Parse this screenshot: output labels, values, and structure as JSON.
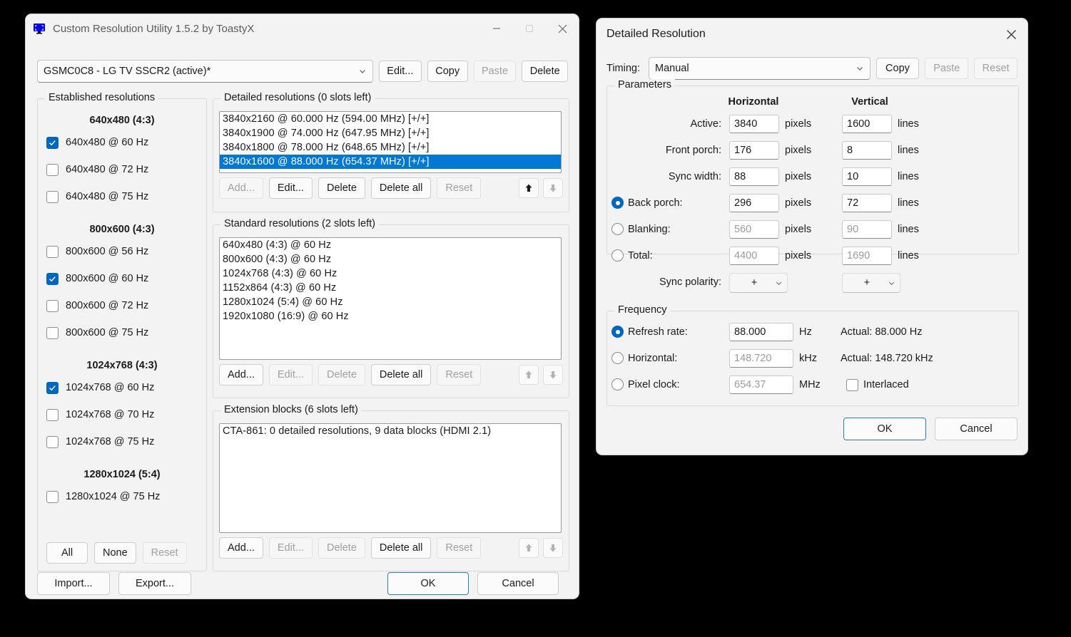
{
  "main_window": {
    "title": "Custom Resolution Utility 1.5.2 by ToastyX",
    "icon": "monitor-icon",
    "window_controls": {
      "minimize": "minimize-icon",
      "maximize": "maximize-icon",
      "close": "close-icon"
    },
    "display_selector": {
      "value": "GSMC0C8 - LG TV SSCR2 (active)*",
      "chevron": "chevron-down-icon"
    },
    "top_buttons": [
      {
        "label": "Edit...",
        "enabled": true
      },
      {
        "label": "Copy",
        "enabled": true
      },
      {
        "label": "Paste",
        "enabled": false
      },
      {
        "label": "Delete",
        "enabled": true
      }
    ],
    "established": {
      "legend": "Established resolutions",
      "groups": [
        {
          "header": "640x480 (4:3)",
          "items": [
            {
              "label": "640x480 @ 60 Hz",
              "checked": true
            },
            {
              "label": "640x480 @ 72 Hz",
              "checked": false
            },
            {
              "label": "640x480 @ 75 Hz",
              "checked": false
            }
          ]
        },
        {
          "header": "800x600 (4:3)",
          "items": [
            {
              "label": "800x600 @ 56 Hz",
              "checked": false
            },
            {
              "label": "800x600 @ 60 Hz",
              "checked": true
            },
            {
              "label": "800x600 @ 72 Hz",
              "checked": false
            },
            {
              "label": "800x600 @ 75 Hz",
              "checked": false
            }
          ]
        },
        {
          "header": "1024x768 (4:3)",
          "items": [
            {
              "label": "1024x768 @ 60 Hz",
              "checked": true
            },
            {
              "label": "1024x768 @ 70 Hz",
              "checked": false
            },
            {
              "label": "1024x768 @ 75 Hz",
              "checked": false
            }
          ]
        },
        {
          "header": "1280x1024 (5:4)",
          "items": [
            {
              "label": "1280x1024 @ 75 Hz",
              "checked": false
            }
          ]
        }
      ],
      "buttons": [
        {
          "label": "All",
          "enabled": true
        },
        {
          "label": "None",
          "enabled": true
        },
        {
          "label": "Reset",
          "enabled": false
        }
      ]
    },
    "detailed": {
      "legend": "Detailed resolutions (0 slots left)",
      "rows": [
        {
          "text": "3840x2160 @ 60.000 Hz (594.00 MHz) [+/+]",
          "selected": false
        },
        {
          "text": "3840x1900 @ 74.000 Hz (647.95 MHz) [+/+]",
          "selected": false
        },
        {
          "text": "3840x1800 @ 78.000 Hz (648.65 MHz) [+/+]",
          "selected": false
        },
        {
          "text": "3840x1600 @ 88.000 Hz (654.37 MHz) [+/+]",
          "selected": true
        }
      ],
      "buttons": [
        {
          "label": "Add...",
          "enabled": false
        },
        {
          "label": "Edit...",
          "enabled": true
        },
        {
          "label": "Delete",
          "enabled": true
        },
        {
          "label": "Delete all",
          "enabled": true
        },
        {
          "label": "Reset",
          "enabled": false
        }
      ],
      "move_up": {
        "icon": "arrow-up-icon",
        "enabled": true
      },
      "move_down": {
        "icon": "arrow-down-icon",
        "enabled": false
      }
    },
    "standard": {
      "legend": "Standard resolutions (2 slots left)",
      "rows": [
        {
          "text": "640x480 (4:3) @ 60 Hz",
          "selected": false
        },
        {
          "text": "800x600 (4:3) @ 60 Hz",
          "selected": false
        },
        {
          "text": "1024x768 (4:3) @ 60 Hz",
          "selected": false
        },
        {
          "text": "1152x864 (4:3) @ 60 Hz",
          "selected": false
        },
        {
          "text": "1280x1024 (5:4) @ 60 Hz",
          "selected": false
        },
        {
          "text": "1920x1080 (16:9) @ 60 Hz",
          "selected": false
        }
      ],
      "buttons": [
        {
          "label": "Add...",
          "enabled": true
        },
        {
          "label": "Edit...",
          "enabled": false
        },
        {
          "label": "Delete",
          "enabled": false
        },
        {
          "label": "Delete all",
          "enabled": true
        },
        {
          "label": "Reset",
          "enabled": false
        }
      ],
      "move_up": {
        "icon": "arrow-up-icon",
        "enabled": false
      },
      "move_down": {
        "icon": "arrow-down-icon",
        "enabled": false
      }
    },
    "extension": {
      "legend": "Extension blocks (6 slots left)",
      "rows": [
        {
          "text": "CTA-861: 0 detailed resolutions, 9 data blocks (HDMI 2.1)",
          "selected": false
        }
      ],
      "buttons": [
        {
          "label": "Add...",
          "enabled": true
        },
        {
          "label": "Edit...",
          "enabled": false
        },
        {
          "label": "Delete",
          "enabled": false
        },
        {
          "label": "Delete all",
          "enabled": true
        },
        {
          "label": "Reset",
          "enabled": false
        }
      ],
      "move_up": {
        "icon": "arrow-up-icon",
        "enabled": false
      },
      "move_down": {
        "icon": "arrow-down-icon",
        "enabled": false
      }
    },
    "footer": {
      "import_label": "Import...",
      "export_label": "Export...",
      "ok_label": "OK",
      "cancel_label": "Cancel"
    }
  },
  "dialog": {
    "title": "Detailed Resolution",
    "close_icon": "close-icon",
    "timing": {
      "label": "Timing:",
      "value": "Manual",
      "chevron": "chevron-down-icon",
      "buttons": [
        {
          "label": "Copy",
          "enabled": true
        },
        {
          "label": "Paste",
          "enabled": false
        },
        {
          "label": "Reset",
          "enabled": false
        }
      ]
    },
    "parameters": {
      "legend": "Parameters",
      "col_horizontal": "Horizontal",
      "col_vertical": "Vertical",
      "unit_pixels": "pixels",
      "unit_lines": "lines",
      "rows": [
        {
          "label": "Active:",
          "radio": null,
          "h": "3840",
          "v": "1600",
          "readonly": false
        },
        {
          "label": "Front porch:",
          "radio": null,
          "h": "176",
          "v": "8",
          "readonly": false
        },
        {
          "label": "Sync width:",
          "radio": null,
          "h": "88",
          "v": "10",
          "readonly": false
        },
        {
          "label": "Back porch:",
          "radio": true,
          "h": "296",
          "v": "72",
          "readonly": false
        },
        {
          "label": "Blanking:",
          "radio": false,
          "h": "560",
          "v": "90",
          "readonly": true
        },
        {
          "label": "Total:",
          "radio": false,
          "h": "4400",
          "v": "1690",
          "readonly": true
        }
      ],
      "sync_polarity": {
        "label": "Sync polarity:",
        "h": "+",
        "v": "+",
        "chevron": "chevron-down-icon"
      }
    },
    "frequency": {
      "legend": "Frequency",
      "rows": [
        {
          "label": "Refresh rate:",
          "radio": true,
          "value": "88.000",
          "unit": "Hz",
          "actual": "Actual: 88.000 Hz",
          "readonly": false
        },
        {
          "label": "Horizontal:",
          "radio": false,
          "value": "148.720",
          "unit": "kHz",
          "actual": "Actual: 148.720 kHz",
          "readonly": true
        },
        {
          "label": "Pixel clock:",
          "radio": false,
          "value": "654.37",
          "unit": "MHz",
          "actual": "",
          "readonly": true
        }
      ],
      "interlaced": {
        "label": "Interlaced",
        "checked": false
      }
    },
    "footer": {
      "ok_label": "OK",
      "cancel_label": "Cancel"
    }
  },
  "colors": {
    "accent": "#0078d4",
    "accent_check": "#0067c0",
    "window_bg": "#f3f3f3",
    "desktop_bg": "#000000",
    "disabled_text": "#a0a0a0"
  }
}
